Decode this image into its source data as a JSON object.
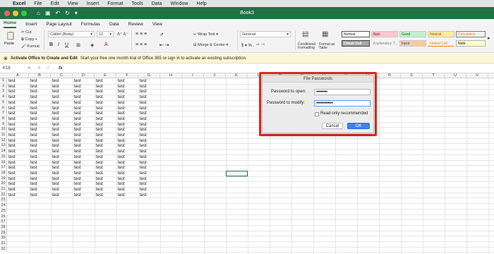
{
  "menubar": {
    "apple": "",
    "app": "Excel",
    "items": [
      "File",
      "Edit",
      "View",
      "Insert",
      "Format",
      "Tools",
      "Data",
      "Window",
      "Help"
    ]
  },
  "titlebar": {
    "document": "Book3"
  },
  "tabs": [
    "Home",
    "Insert",
    "Page Layout",
    "Formulas",
    "Data",
    "Review",
    "View"
  ],
  "ribbon": {
    "paste": "Paste",
    "cut": "Cut",
    "copy": "Copy",
    "format": "Format",
    "font_name": "Calibri (Body)",
    "font_size": "12",
    "wrap_text": "Wrap Text",
    "merge_center": "Merge & Center",
    "number_format": "General",
    "conditional_formatting": "Conditional Formatting",
    "format_as_table": "Format as Table",
    "styles": [
      {
        "label": "Normal",
        "bg": "#ffffff",
        "color": "#000000"
      },
      {
        "label": "Bad",
        "bg": "#ffc7ce",
        "color": "#9c0006"
      },
      {
        "label": "Good",
        "bg": "#c6efce",
        "color": "#006100"
      },
      {
        "label": "Neutral",
        "bg": "#ffeb9c",
        "color": "#9c5700"
      },
      {
        "label": "Calculation",
        "bg": "#f2f2f2",
        "color": "#fa7d00"
      },
      {
        "label": "Check Cell",
        "bg": "#a5a5a5",
        "color": "#ffffff"
      },
      {
        "label": "Explanatory T...",
        "bg": "#f3f3f3",
        "color": "#7f7f7f"
      },
      {
        "label": "Input",
        "bg": "#ffcc99",
        "color": "#3f3f76"
      },
      {
        "label": "Linked Cell",
        "bg": "#f3f3f3",
        "color": "#fa7d00"
      },
      {
        "label": "Note",
        "bg": "#ffffcc",
        "color": "#000000"
      }
    ]
  },
  "infobar": {
    "title": "Activate Office to Create and Edit",
    "message": "Start your free one month trial of Office 365 or sign in to activate an existing subscription."
  },
  "formulabar": {
    "cell_ref": "K18",
    "fx": "fx"
  },
  "sheet": {
    "columns": [
      "A",
      "B",
      "C",
      "D",
      "E",
      "F",
      "G",
      "H",
      "I",
      "J",
      "K",
      "L",
      "M",
      "N",
      "O",
      "P",
      "Q",
      "R",
      "S",
      "T",
      "U",
      "V"
    ],
    "rows": [
      "1",
      "2",
      "3",
      "4",
      "5",
      "6",
      "7",
      "8",
      "9",
      "10",
      "11",
      "12",
      "13",
      "14",
      "15",
      "16",
      "17",
      "18",
      "19",
      "20",
      "21",
      "22",
      "23",
      "24",
      "25",
      "26",
      "27",
      "28",
      "29",
      "30",
      "31",
      "32"
    ],
    "cell_value": "test"
  },
  "dialog": {
    "title": "File Passwords",
    "open_label": "Password to open:",
    "open_value": "••••••••",
    "modify_label": "Password to modify:",
    "modify_value": "••••••••••••",
    "readonly_label": "Read-only recommended",
    "cancel": "Cancel",
    "ok": "OK"
  },
  "colors": {
    "excel_green": "#207245",
    "highlight_red": "#e02b1c",
    "ok_blue": "#3b82f6"
  }
}
